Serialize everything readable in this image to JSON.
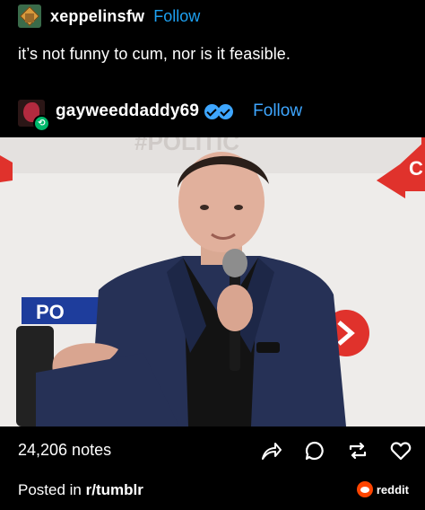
{
  "post": {
    "author": {
      "username": "xeppelinsfw",
      "follow_label": "Follow"
    },
    "text": "it’s not funny to cum, nor is it feasible.",
    "reblog": {
      "username": "gayweeddaddy69",
      "follow_label": "Follow",
      "verified_badges": 2
    },
    "image": {
      "background_sign_text": "#POLITIC"
    },
    "notes": "24,206 notes",
    "actions": [
      {
        "name": "share",
        "icon": "share-icon"
      },
      {
        "name": "reply",
        "icon": "reply-icon"
      },
      {
        "name": "reblog",
        "icon": "reblog-icon"
      },
      {
        "name": "like",
        "icon": "heart-icon"
      }
    ]
  },
  "footer": {
    "posted_prefix": "Posted in ",
    "subreddit": "r/tumblr",
    "brand": "reddit"
  },
  "colors": {
    "background": "#000000",
    "follow": "#3ea6ff",
    "reblog_badge": "#00b86b",
    "reddit": "#ff4500"
  }
}
